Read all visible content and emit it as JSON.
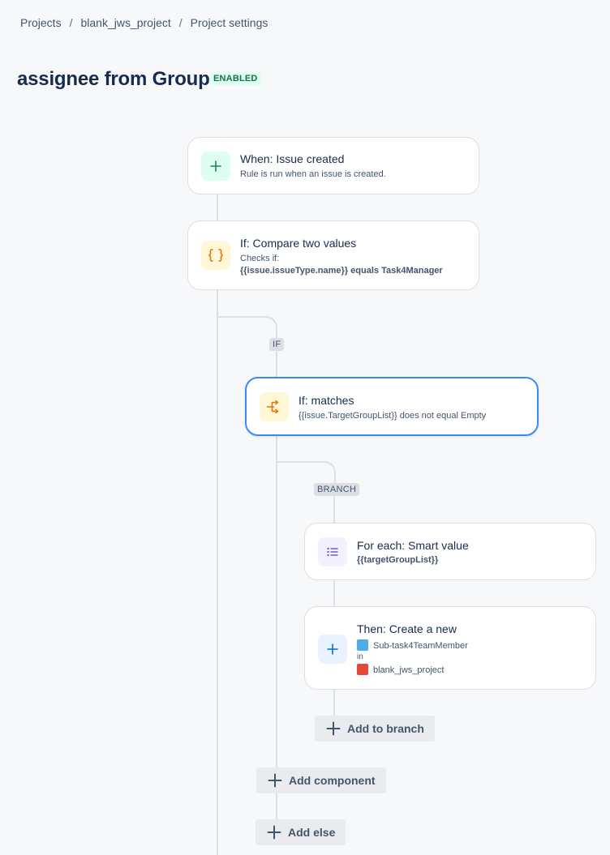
{
  "breadcrumb": {
    "items": [
      "Projects",
      "blank_jws_project",
      "Project settings"
    ],
    "separator": "/"
  },
  "page": {
    "title": "assignee from Group",
    "status": "ENABLED"
  },
  "flow": {
    "trigger": {
      "title": "When: Issue created",
      "description": "Rule is run when an issue is created.",
      "icon": "plus-icon"
    },
    "condition": {
      "title": "If: Compare two values",
      "label": "Checks if:",
      "expression_value": "{{issue.issueType.name}}",
      "expression_operator": "equals",
      "expression_compare": "Task4Manager",
      "icon": "braces-icon"
    },
    "if_tag": "IF",
    "if_block": {
      "title": "If: matches",
      "description": "{{issue.TargetGroupList}} does not equal Empty",
      "icon": "branch-arrow-icon"
    },
    "branch_tag": "BRANCH",
    "branch": {
      "title": "For each: Smart value",
      "value": "{{targetGroupList}}",
      "icon": "list-icon"
    },
    "action": {
      "title": "Then: Create a new",
      "issue_type": "Sub-task4TeamMember",
      "in_label": "in",
      "project": "blank_jws_project",
      "icon": "plus-icon"
    },
    "buttons": {
      "add_to_branch": "Add to branch",
      "add_component": "Add component",
      "add_else": "Add else"
    }
  },
  "colors": {
    "accent_blue": "#388bff",
    "trigger_bg": "#dcfff1",
    "trigger_icon": "#1f845a",
    "condition_bg": "#fff7d6",
    "condition_icon": "#e2740e",
    "branch_bg": "#f3f0ff",
    "branch_icon": "#6e5dc6",
    "action_bg": "#e9f2ff",
    "action_icon": "#0c66e4",
    "enabled_badge_bg": "#dcfff1",
    "enabled_badge_text": "#216e4e"
  }
}
